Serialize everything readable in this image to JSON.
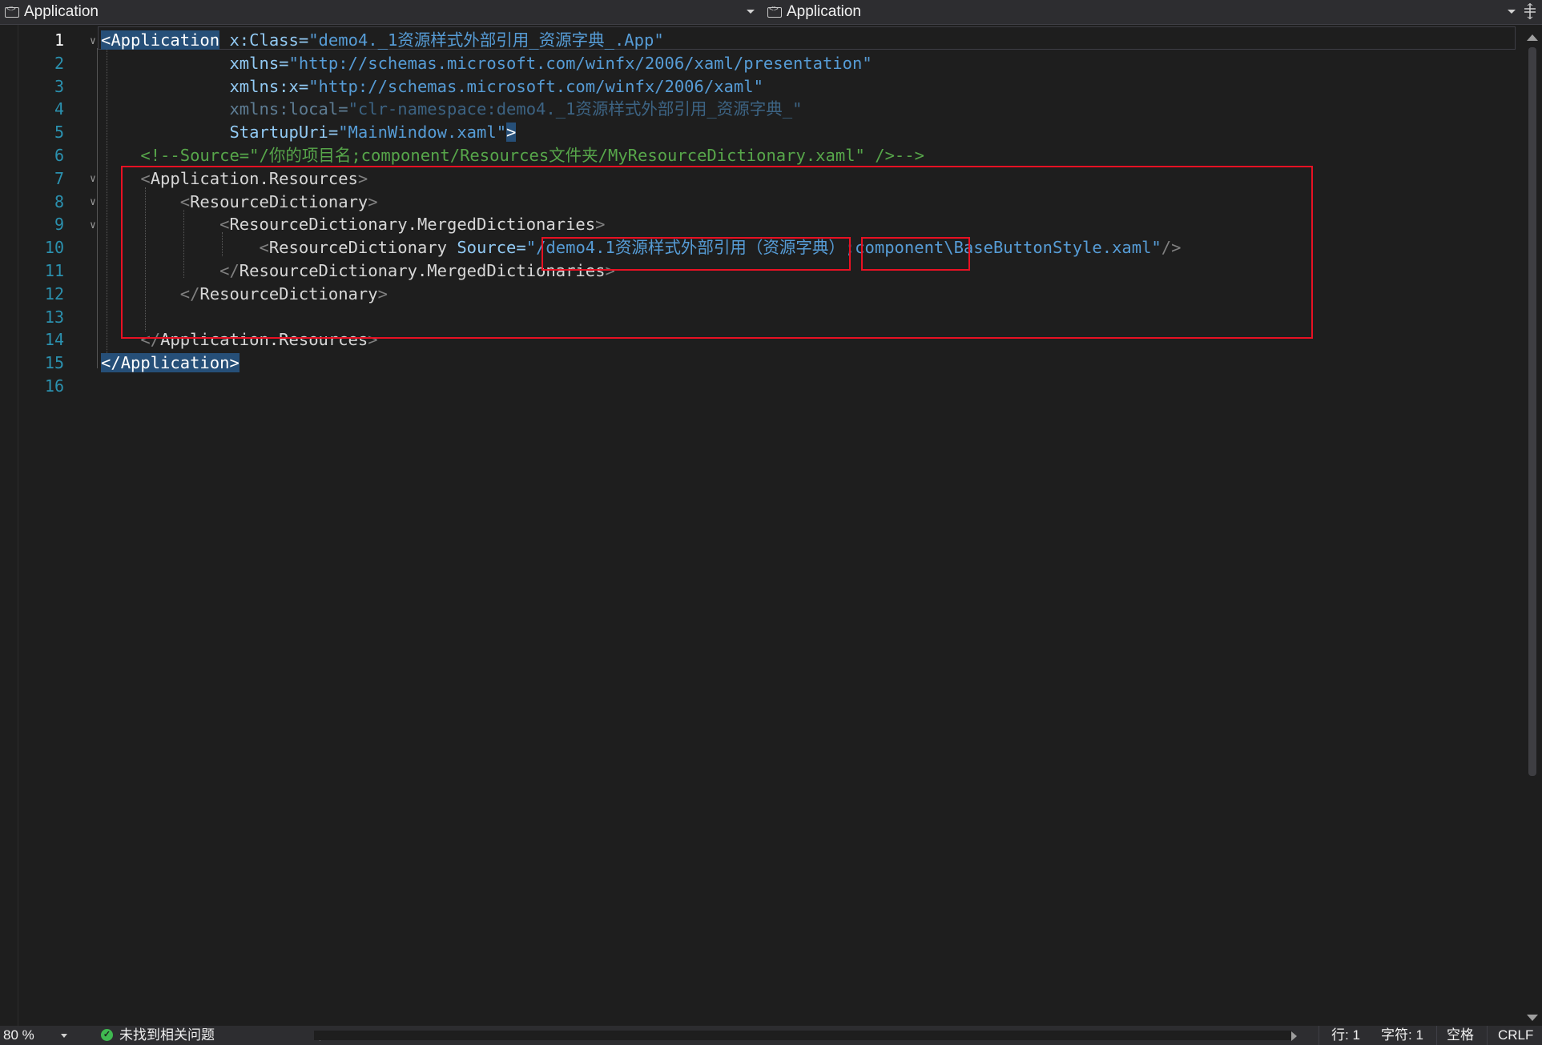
{
  "nav": {
    "left_dropdown": {
      "icon": "xaml-element-icon",
      "label": "Application"
    },
    "right_dropdown": {
      "icon": "xaml-element-icon",
      "label": "Application"
    },
    "split_button": "split-editor-icon"
  },
  "editor": {
    "line_numbers": [
      "1",
      "2",
      "3",
      "4",
      "5",
      "6",
      "7",
      "8",
      "9",
      "10",
      "11",
      "12",
      "13",
      "14",
      "15",
      "16"
    ],
    "lines": [
      {
        "tokens": [
          {
            "t": "<",
            "c": "br hl"
          },
          {
            "t": "Application",
            "c": "tag hl"
          },
          {
            "t": " x:Class=",
            "c": "at"
          },
          {
            "t": "\"",
            "c": "q"
          },
          {
            "t": "demo4._1资源样式外部引用_资源字典_.App",
            "c": "val"
          },
          {
            "t": "\"",
            "c": "q"
          }
        ]
      },
      {
        "tokens": [
          {
            "t": "             xmlns=",
            "c": "at"
          },
          {
            "t": "\"http://schemas.microsoft.com/winfx/2006/xaml/presentation\"",
            "c": "val"
          }
        ]
      },
      {
        "tokens": [
          {
            "t": "             xmlns:x=",
            "c": "at"
          },
          {
            "t": "\"http://schemas.microsoft.com/winfx/2006/xaml\"",
            "c": "val"
          }
        ]
      },
      {
        "tokens": [
          {
            "t": "             xmlns:local=",
            "c": "at dim"
          },
          {
            "t": "\"clr-namespace:demo4._1资源样式外部引用_资源字典_\"",
            "c": "val dim"
          }
        ]
      },
      {
        "tokens": [
          {
            "t": "             StartupUri=",
            "c": "at"
          },
          {
            "t": "\"MainWindow.xaml\"",
            "c": "val"
          },
          {
            "t": ">",
            "c": "br hl"
          }
        ]
      },
      {
        "tokens": [
          {
            "t": "    <!--Source=\"/你的项目名;component/Resources文件夹/MyResourceDictionary.xaml\" />-->",
            "c": "com"
          }
        ]
      },
      {
        "tokens": [
          {
            "t": "    <",
            "c": "br"
          },
          {
            "t": "Application.Resources",
            "c": "tag"
          },
          {
            "t": ">",
            "c": "br"
          }
        ]
      },
      {
        "tokens": [
          {
            "t": "        <",
            "c": "br"
          },
          {
            "t": "ResourceDictionary",
            "c": "tag"
          },
          {
            "t": ">",
            "c": "br"
          }
        ]
      },
      {
        "tokens": [
          {
            "t": "            <",
            "c": "br"
          },
          {
            "t": "ResourceDictionary.MergedDictionaries",
            "c": "tag"
          },
          {
            "t": ">",
            "c": "br"
          }
        ]
      },
      {
        "tokens": [
          {
            "t": "                <",
            "c": "br"
          },
          {
            "t": "ResourceDictionary",
            "c": "tag"
          },
          {
            "t": " Source=",
            "c": "at"
          },
          {
            "t": "\"/demo4.1资源样式外部引用（资源字典）;component\\BaseButtonStyle.xaml\"",
            "c": "val"
          },
          {
            "t": "/>",
            "c": "br"
          }
        ]
      },
      {
        "tokens": [
          {
            "t": "            </",
            "c": "br"
          },
          {
            "t": "ResourceDictionary.MergedDictionaries",
            "c": "tag"
          },
          {
            "t": ">",
            "c": "br"
          }
        ]
      },
      {
        "tokens": [
          {
            "t": "        </",
            "c": "br"
          },
          {
            "t": "ResourceDictionary",
            "c": "tag"
          },
          {
            "t": ">",
            "c": "br"
          }
        ]
      },
      {
        "tokens": [
          {
            "t": "",
            "c": "tag"
          }
        ]
      },
      {
        "tokens": [
          {
            "t": "    </",
            "c": "br"
          },
          {
            "t": "Application.Resources",
            "c": "tag"
          },
          {
            "t": ">",
            "c": "br"
          }
        ]
      },
      {
        "tokens": [
          {
            "t": "</",
            "c": "br hl"
          },
          {
            "t": "Application",
            "c": "tag hl"
          },
          {
            "t": ">",
            "c": "br hl"
          }
        ]
      },
      {
        "tokens": [
          {
            "t": "",
            "c": "tag"
          }
        ]
      }
    ]
  },
  "annotations": {
    "color": "#e81123"
  },
  "status": {
    "zoom": "80 %",
    "issues_icon": "check-circle-icon",
    "issues": "未找到相关问题",
    "line": "行: 1",
    "char": "字符: 1",
    "whitespace": "空格",
    "line_ending": "CRLF"
  }
}
